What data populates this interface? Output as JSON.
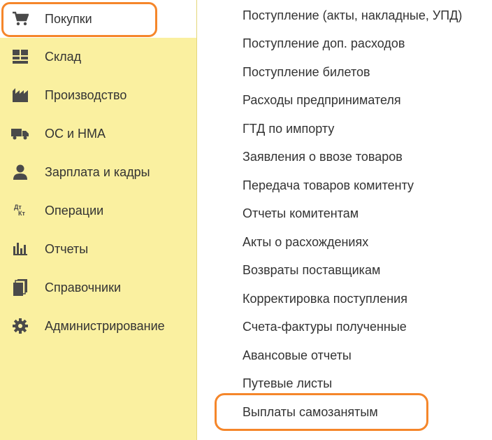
{
  "sidebar": {
    "items": [
      {
        "label": "Покупки",
        "icon": "cart-icon",
        "active": true
      },
      {
        "label": "Склад",
        "icon": "warehouse-grid-icon"
      },
      {
        "label": "Производство",
        "icon": "factory-icon"
      },
      {
        "label": "ОС и НМА",
        "icon": "truck-icon"
      },
      {
        "label": "Зарплата и кадры",
        "icon": "person-icon"
      },
      {
        "label": "Операции",
        "icon": "debit-credit-icon",
        "icon_text": [
          "Дт",
          "Кт"
        ]
      },
      {
        "label": "Отчеты",
        "icon": "bar-chart-icon"
      },
      {
        "label": "Справочники",
        "icon": "books-icon"
      },
      {
        "label": "Администрирование",
        "icon": "gear-icon"
      }
    ]
  },
  "menu": {
    "items": [
      "Поступление (акты, накладные, УПД)",
      "Поступление доп. расходов",
      "Поступление билетов",
      "Расходы предпринимателя",
      "ГТД по импорту",
      "Заявления о ввозе товаров",
      "Передача товаров комитенту",
      "Отчеты комитентам",
      "Акты о расхождениях",
      "Возвраты поставщикам",
      "Корректировка поступления",
      "Счета-фактуры полученные",
      "Авансовые отчеты",
      "Путевые листы",
      "Выплаты самозанятым"
    ]
  },
  "colors": {
    "sidebar_bg": "#faf0a0",
    "highlight": "#f5862a",
    "text": "#333333"
  }
}
